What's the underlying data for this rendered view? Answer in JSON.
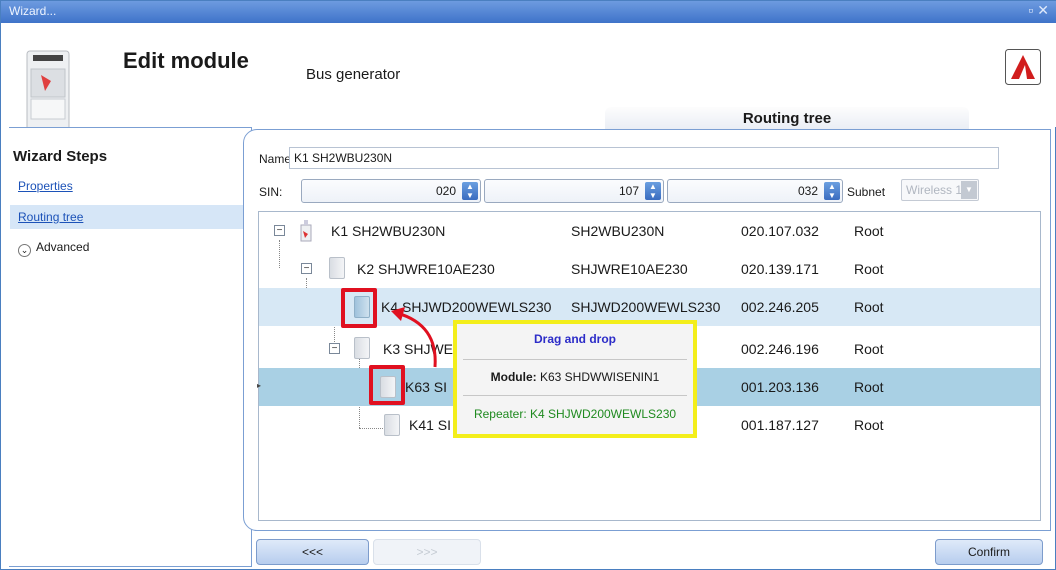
{
  "window": {
    "title": "Wizard..."
  },
  "header": {
    "title": "Edit module",
    "subtitle": "Bus generator",
    "tab_label": "Routing tree"
  },
  "sidebar": {
    "heading": "Wizard Steps",
    "items": [
      {
        "label": "Properties"
      },
      {
        "label": "Routing tree"
      },
      {
        "label": "Advanced"
      }
    ]
  },
  "form": {
    "name_label": "Name",
    "name_value": "K1 SH2WBU230N",
    "sin_label": "SIN:",
    "sin_values": [
      "020",
      "107",
      "032"
    ],
    "subnet_label": "Subnet",
    "subnet_value": "Wireless 1"
  },
  "tree": {
    "rows": [
      {
        "name": "K1 SH2WBU230N",
        "model": "SH2WBU230N",
        "sin": "020.107.032",
        "route": "Root"
      },
      {
        "name": "K2 SHJWRE10AE230",
        "model": "SHJWRE10AE230",
        "sin": "020.139.171",
        "route": "Root"
      },
      {
        "name": "K4 SHJWD200WEWLS230",
        "model": "SHJWD200WEWLS230",
        "sin": "002.246.205",
        "route": "Root"
      },
      {
        "name": "K3 SHJWE",
        "model": "",
        "sin": "002.246.196",
        "route": "Root"
      },
      {
        "name": "K63 SI",
        "model": "",
        "sin": "001.203.136",
        "route": "Root"
      },
      {
        "name": "K41 SI",
        "model": "",
        "sin": "001.187.127",
        "route": "Root"
      }
    ]
  },
  "tooltip": {
    "title": "Drag and drop",
    "module_label": "Module:",
    "module_value": "K63 SHDWWISENIN1",
    "repeater_label": "Repeater: K4 SHJWD200WEWLS230"
  },
  "footer": {
    "back_label": "<<<",
    "next_label": ">>>",
    "confirm_label": "Confirm"
  },
  "colors": {
    "titlebar": "#4a7fc0",
    "highlight_selected": "#a9d0e4",
    "highlight_hover": "#d7e8f5",
    "annotation_red": "#e01020",
    "annotation_yellow": "#f3ee1a"
  }
}
